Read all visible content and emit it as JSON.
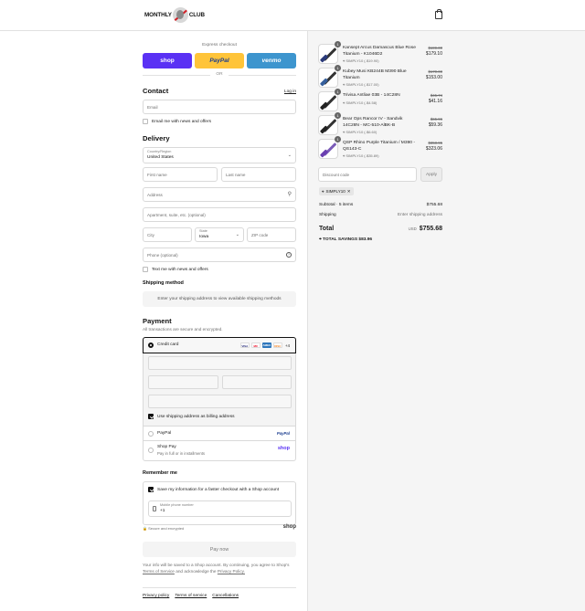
{
  "header": {
    "logo_left": "MONTHLY",
    "logo_right": "CLUB",
    "cart_icon": "bag-icon"
  },
  "express": {
    "title": "Express checkout",
    "shop": "shop",
    "paypal": "PayPal",
    "venmo": "venmo",
    "or": "OR",
    "colors": {
      "shop": "#5a31f4",
      "paypal": "#ffc439",
      "venmo": "#3d95ce"
    }
  },
  "contact": {
    "title": "Contact",
    "login": "Log in",
    "email_placeholder": "Email",
    "news_label": "Email me with news and offers"
  },
  "delivery": {
    "title": "Delivery",
    "country_label": "Country/Region",
    "country": "United States",
    "first": "First name",
    "last": "Last name",
    "address": "Address",
    "apartment": "Apartment, suite, etc. (optional)",
    "city": "City",
    "state_label": "State",
    "state": "Iowa",
    "zip": "ZIP code",
    "phone": "Phone (optional)",
    "text_label": "Text me with news and offers"
  },
  "shipping": {
    "title": "Shipping method",
    "msg": "Enter your shipping address to view available shipping methods"
  },
  "payment": {
    "title": "Payment",
    "subtitle": "All transactions are secure and encrypted.",
    "credit_card": "Credit card",
    "more_cards": "+4",
    "card_brands": [
      "VISA",
      "MC",
      "AMEX",
      "DISC"
    ],
    "billing_label": "Use shipping address as billing address",
    "paypal": "PayPal",
    "paypal_logo": "PayPal",
    "shoppay": "Shop Pay",
    "shoppay_sub": "Pay in full or in installments",
    "shoppay_logo": "shop"
  },
  "remember": {
    "title": "Remember me",
    "save_label": "Save my information for a faster checkout with a Shop account",
    "mobile_label": "Mobile phone number",
    "mobile_value": "+1",
    "secure": "Secure and encrypted",
    "shop": "shop"
  },
  "pay_now": "Pay now",
  "legal": {
    "text": "Your info will be saved to a Shop account. By continuing, you agree to Shop's",
    "tos": "Terms of Service",
    "and": "and acknowledge the",
    "privacy": "Privacy Policy."
  },
  "footer": [
    "Privacy policy",
    "Terms of service",
    "Cancellations"
  ],
  "items": [
    {
      "qty": "1",
      "name": "Kansept Arcus Damascus Blue Rose Titanium - K1046D2",
      "discount": "SIMPLY10 (-$19.90)",
      "old": "$199.00",
      "price": "$179.10"
    },
    {
      "qty": "1",
      "name": "Kubey Musi KB244B M390 Blue Titanium",
      "discount": "SIMPLY10 (-$17.00)",
      "old": "$170.00",
      "price": "$153.00"
    },
    {
      "qty": "1",
      "name": "Trivisa Antliae 03B - 14C28N",
      "discount": "SIMPLY10 (-$4.58)",
      "old": "$45.74",
      "price": "$41.16"
    },
    {
      "qty": "1",
      "name": "Bear Ops Rancor IV - Sandvik 14C28N - MC-510-AlBK-B",
      "discount": "SIMPLY10 (-$6.60)",
      "old": "$65.96",
      "price": "$59.36"
    },
    {
      "qty": "1",
      "name": "QSP Rhino Purple Titanium / M390 - QS143-C",
      "discount": "SIMPLY10 (-$35.89)",
      "old": "$358.95",
      "price": "$323.06"
    }
  ],
  "summary": {
    "discount_placeholder": "Discount code",
    "apply": "Apply",
    "applied_code": "SIMPLY10",
    "subtotal_label": "Subtotal · 5 items",
    "subtotal": "$755.68",
    "shipping_label": "Shipping",
    "shipping_value": "Enter shipping address",
    "total_label": "Total",
    "currency": "USD",
    "total": "$755.68",
    "savings_label": "TOTAL SAVINGS",
    "savings": "$83.96"
  }
}
